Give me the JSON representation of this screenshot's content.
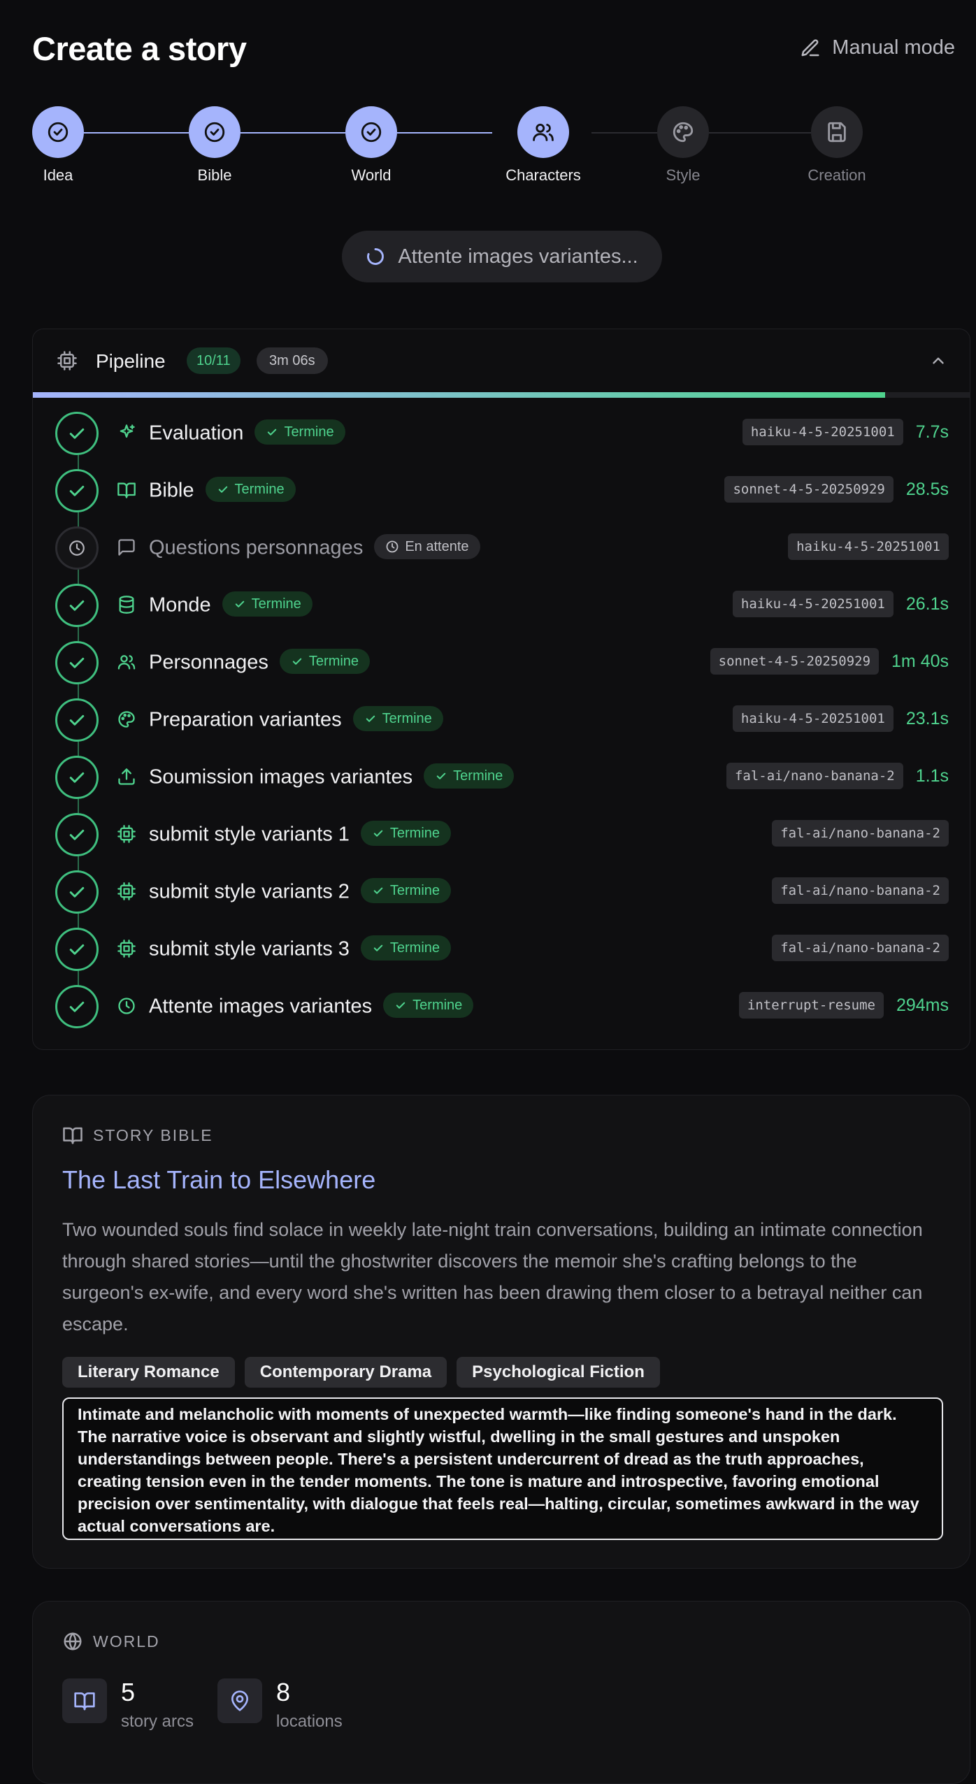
{
  "header": {
    "title": "Create a story",
    "manual_mode": "Manual mode"
  },
  "stepper": {
    "steps": [
      {
        "label": "Idea",
        "state": "done",
        "icon": "check-circle-icon"
      },
      {
        "label": "Bible",
        "state": "done",
        "icon": "check-circle-icon"
      },
      {
        "label": "World",
        "state": "done",
        "icon": "check-circle-icon"
      },
      {
        "label": "Characters",
        "state": "active",
        "icon": "users-icon"
      },
      {
        "label": "Style",
        "state": "todo",
        "icon": "palette-icon"
      },
      {
        "label": "Creation",
        "state": "todo",
        "icon": "save-icon"
      }
    ]
  },
  "status": {
    "text": "Attente images variantes..."
  },
  "pipeline": {
    "title": "Pipeline",
    "count": "10/11",
    "elapsed": "3m 06s",
    "progress": 0.91,
    "rows": [
      {
        "name": "Evaluation",
        "icon": "sparkles-icon",
        "status": "Termine",
        "state": "done",
        "model": "haiku-4-5-20251001",
        "duration": "7.7s"
      },
      {
        "name": "Bible",
        "icon": "book-icon",
        "status": "Termine",
        "state": "done",
        "model": "sonnet-4-5-20250929",
        "duration": "28.5s"
      },
      {
        "name": "Questions personnages",
        "icon": "message-icon",
        "status": "En attente",
        "state": "wait",
        "model": "haiku-4-5-20251001",
        "duration": ""
      },
      {
        "name": "Monde",
        "icon": "database-icon",
        "status": "Termine",
        "state": "done",
        "model": "haiku-4-5-20251001",
        "duration": "26.1s"
      },
      {
        "name": "Personnages",
        "icon": "users-icon",
        "status": "Termine",
        "state": "done",
        "model": "sonnet-4-5-20250929",
        "duration": "1m 40s"
      },
      {
        "name": "Preparation variantes",
        "icon": "palette-icon",
        "status": "Termine",
        "state": "done",
        "model": "haiku-4-5-20251001",
        "duration": "23.1s"
      },
      {
        "name": "Soumission images variantes",
        "icon": "upload-icon",
        "status": "Termine",
        "state": "done",
        "model": "fal-ai/nano-banana-2",
        "duration": "1.1s"
      },
      {
        "name": "submit style variants 1",
        "icon": "cpu-icon",
        "status": "Termine",
        "state": "done",
        "model": "fal-ai/nano-banana-2",
        "duration": ""
      },
      {
        "name": "submit style variants 2",
        "icon": "cpu-icon",
        "status": "Termine",
        "state": "done",
        "model": "fal-ai/nano-banana-2",
        "duration": ""
      },
      {
        "name": "submit style variants 3",
        "icon": "cpu-icon",
        "status": "Termine",
        "state": "done",
        "model": "fal-ai/nano-banana-2",
        "duration": ""
      },
      {
        "name": "Attente images variantes",
        "icon": "clock-icon",
        "status": "Termine",
        "state": "done",
        "model": "interrupt-resume",
        "duration": "294ms"
      }
    ]
  },
  "bible": {
    "heading": "STORY BIBLE",
    "title": "The Last Train to Elsewhere",
    "summary": "Two wounded souls find solace in weekly late-night train conversations, building an intimate connection through shared stories—until the ghostwriter discovers the memoir she's crafting belongs to the surgeon's ex-wife, and every word she's written has been drawing them closer to a betrayal neither can escape.",
    "tags": [
      "Literary Romance",
      "Contemporary Drama",
      "Psychological Fiction"
    ],
    "tone": "Intimate and melancholic with moments of unexpected warmth—like finding someone's hand in the dark. The narrative voice is observant and slightly wistful, dwelling in the small gestures and unspoken understandings between people. There's a persistent undercurrent of dread as the truth approaches, creating tension even in the tender moments. The tone is mature and introspective, favoring emotional precision over sentimentality, with dialogue that feels real—halting, circular, sometimes awkward in the way actual conversations are."
  },
  "world": {
    "heading": "WORLD",
    "stats": [
      {
        "value": "5",
        "label": "story arcs",
        "icon": "book-icon"
      },
      {
        "value": "8",
        "label": "locations",
        "icon": "map-pin-icon"
      }
    ]
  },
  "colors": {
    "accent": "#a5b4fc",
    "success": "#4fd38e",
    "background": "#0c0c0e"
  }
}
